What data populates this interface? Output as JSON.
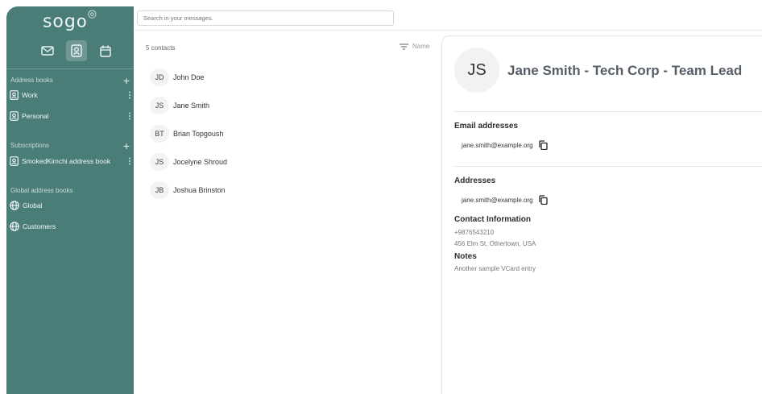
{
  "app": {
    "logo": "SOGo"
  },
  "nav": {
    "items": [
      "mail-icon",
      "contacts-icon",
      "calendar-icon"
    ],
    "active": "contacts-icon"
  },
  "sidebar": {
    "address_books_label": "Address books",
    "address_books": [
      {
        "label": "Work"
      },
      {
        "label": "Personal"
      }
    ],
    "subscriptions_label": "Subscriptions",
    "subscriptions": [
      {
        "label": "SmokedKimchi address book"
      }
    ],
    "global_label": "Global address books",
    "global_books": [
      {
        "label": "Global"
      },
      {
        "label": "Customers"
      }
    ]
  },
  "search": {
    "placeholder": "Search in your messages."
  },
  "list": {
    "count_label": "5 contacts",
    "sort_label": "Name",
    "contacts": [
      {
        "initials": "JD",
        "name": "John Doe"
      },
      {
        "initials": "JS",
        "name": "Jane Smith"
      },
      {
        "initials": "BT",
        "name": "Brian Topgoush"
      },
      {
        "initials": "JS",
        "name": "Jocelyne Shroud"
      },
      {
        "initials": "JB",
        "name": "Joshua Brinston"
      }
    ]
  },
  "detail": {
    "initials": "JS",
    "title": "Jane Smith - Tech Corp - Team Lead",
    "email_heading": "Email addresses",
    "email": "jane.smith@example.org",
    "addresses_heading": "Addresses",
    "address_value": "jane.smith@example.org",
    "contact_info_heading": "Contact Information",
    "phone": "+9876543210",
    "street": "456 Elm St, Othertown, USA",
    "notes_heading": "Notes",
    "notes": "Another sample VCard entry"
  },
  "colors": {
    "sidebar": "#4a7d78",
    "sidebar_active": "#6f9893"
  }
}
